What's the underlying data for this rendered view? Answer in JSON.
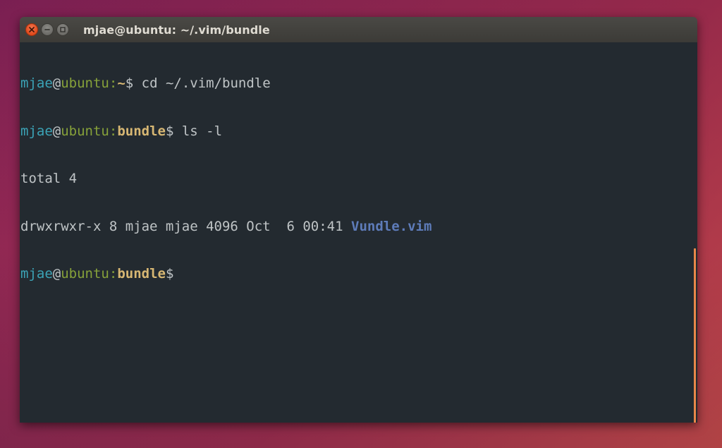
{
  "window": {
    "title": "mjae@ubuntu: ~/.vim/bundle",
    "controls": {
      "close_icon": "close-icon",
      "minimize_icon": "minimize-icon",
      "maximize_icon": "maximize-icon"
    }
  },
  "terminal": {
    "lines": [
      {
        "user": "mjae",
        "at": "@",
        "host": "ubuntu",
        "colon": ":",
        "path": "~",
        "dollar": "$",
        "command": " cd ~/.vim/bundle"
      },
      {
        "user": "mjae",
        "at": "@",
        "host": "ubuntu",
        "colon": ":",
        "path": "bundle",
        "dollar": "$",
        "command": " ls -l"
      },
      {
        "text": "total 4"
      },
      {
        "listing": "drwxrwxr-x 8 mjae mjae 4096 Oct  6 00:41 ",
        "dirname": "Vundle.vim"
      },
      {
        "user": "mjae",
        "at": "@",
        "host": "ubuntu",
        "colon": ":",
        "path": "bundle",
        "dollar": "$",
        "command": ""
      }
    ]
  },
  "colors": {
    "terminal_bg": "#232a30",
    "user": "#3ba3b6",
    "host": "#86a13a",
    "path": "#d7b773",
    "directory": "#5e7cba",
    "scrollbar": "#e8884a"
  }
}
